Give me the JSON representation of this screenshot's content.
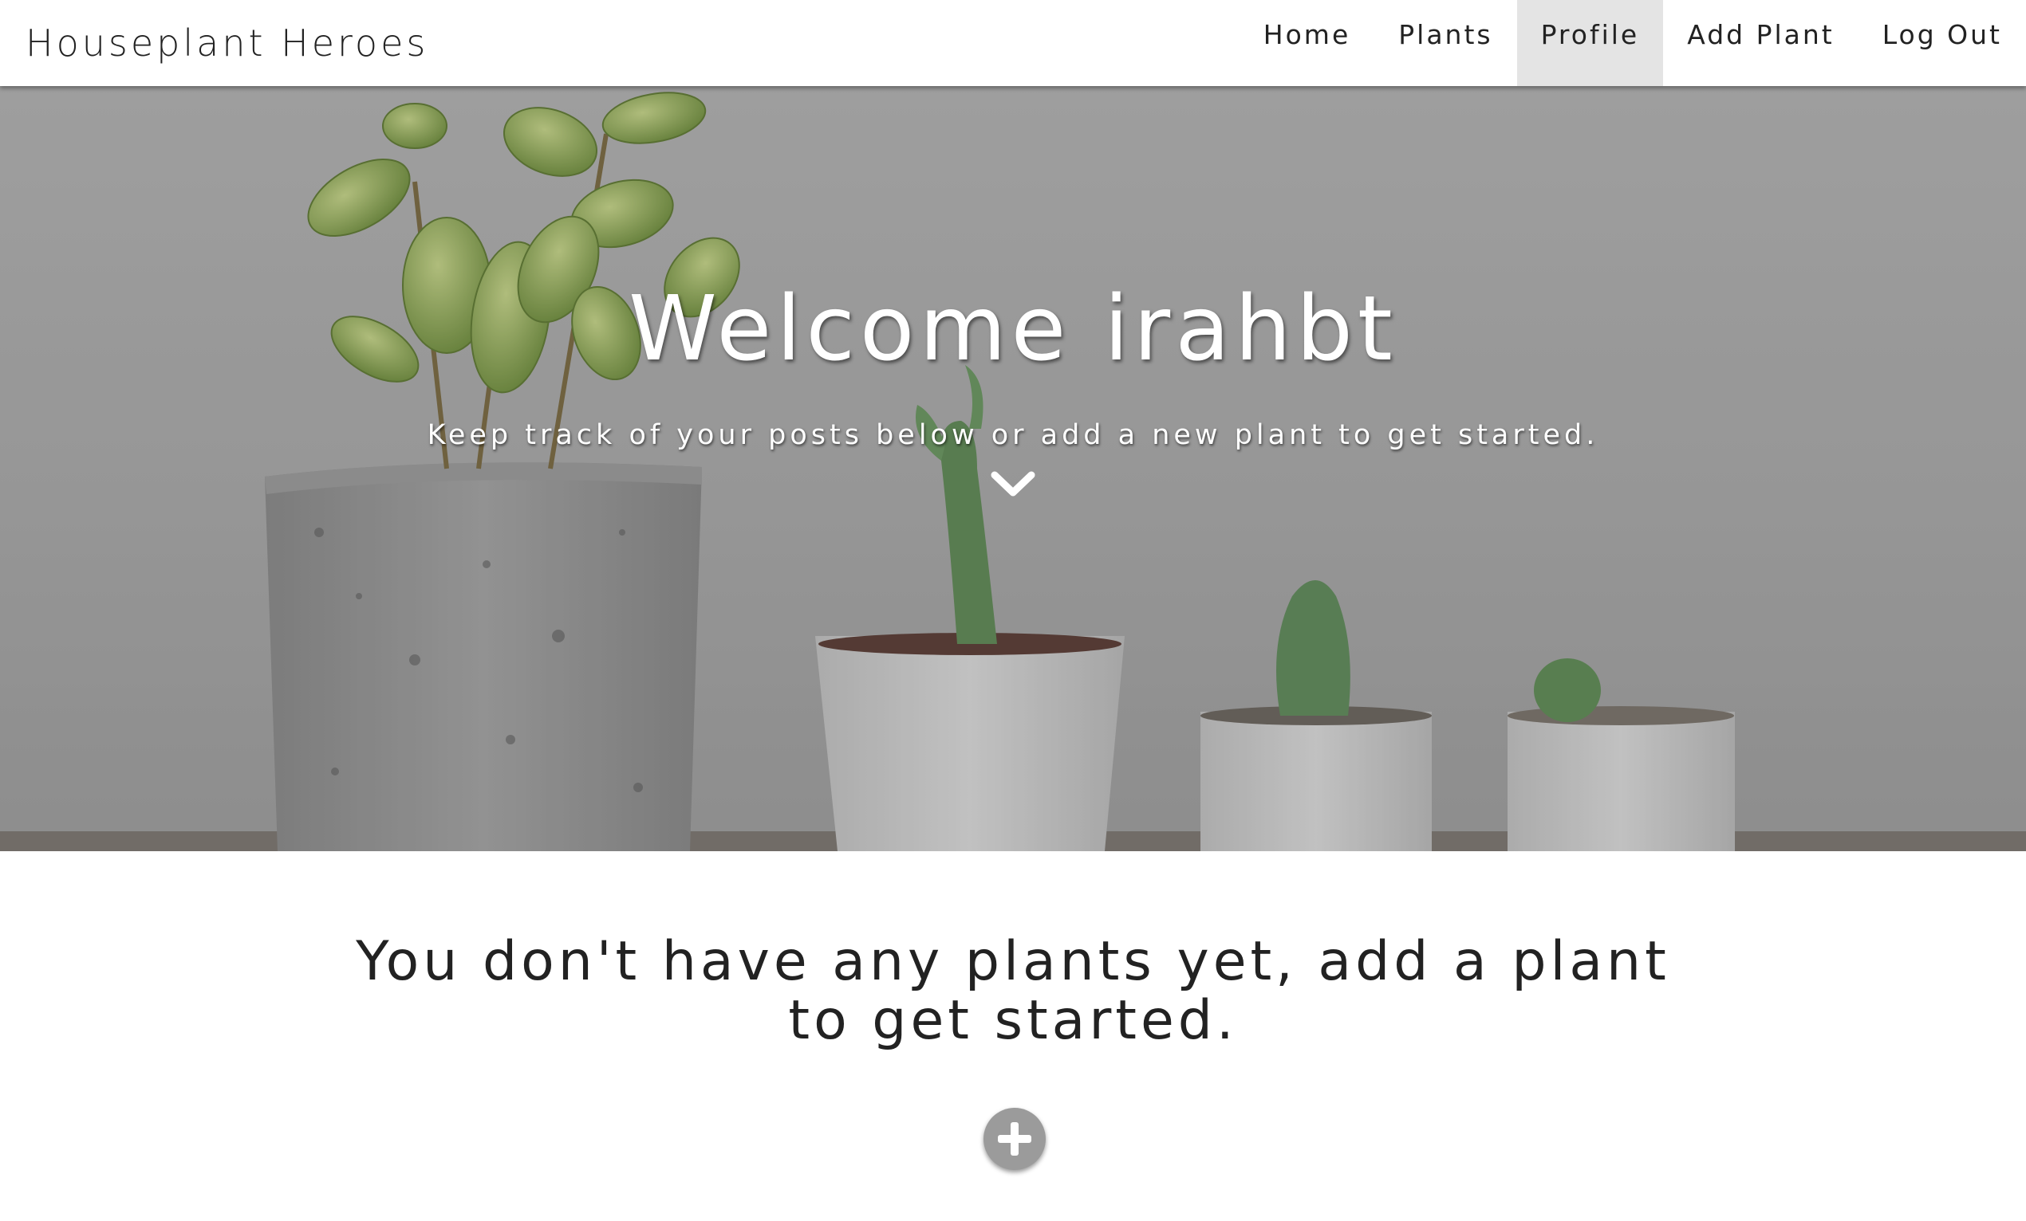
{
  "brand": {
    "name": "Houseplant Heroes"
  },
  "nav": {
    "items": [
      {
        "label": "Home"
      },
      {
        "label": "Plants"
      },
      {
        "label": "Profile",
        "active": true
      },
      {
        "label": "Add Plant"
      },
      {
        "label": "Log Out"
      }
    ]
  },
  "hero": {
    "title": "Welcome irahbt",
    "subtitle": "Keep track of your posts below or add a new plant to get started.",
    "scroll_icon": "chevron-down-icon",
    "image": "potted plants and cacti against a white wall"
  },
  "main": {
    "empty_message": "You don't have any plants yet, add a plant to get started.",
    "add_icon": "plus-circle-icon"
  },
  "colors": {
    "nav_active_bg": "#e4e4e4",
    "add_button_bg": "#9b9b9b",
    "text": "#222222"
  }
}
